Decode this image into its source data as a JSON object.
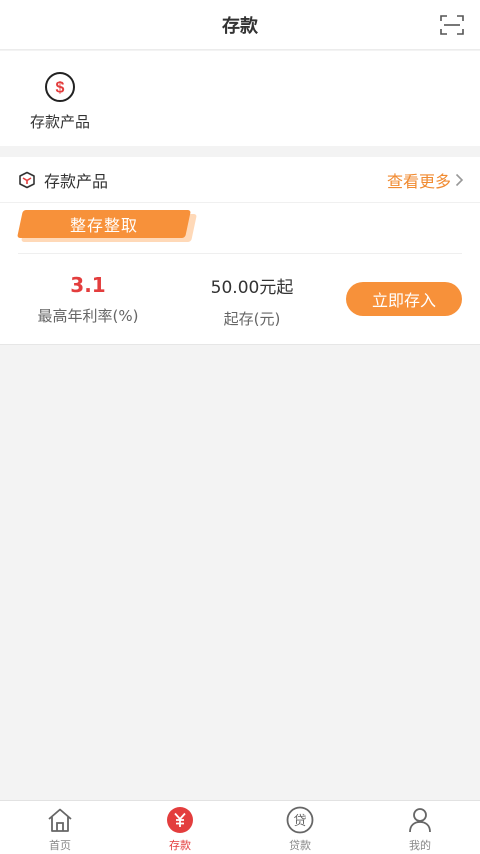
{
  "header": {
    "title": "存款"
  },
  "quick": {
    "items": [
      {
        "label": "存款产品"
      }
    ]
  },
  "section": {
    "title": "存款产品",
    "more_label": "查看更多",
    "tag": "整存整取",
    "product": {
      "rate_value": "3.1",
      "rate_label": "最高年利率(%)",
      "min_value": "50.00元起",
      "min_label": "起存(元)",
      "button_label": "立即存入"
    }
  },
  "tabbar": {
    "items": [
      {
        "label": "首页",
        "icon": "home-icon",
        "active": false
      },
      {
        "label": "存款",
        "icon": "yuan-icon",
        "active": true
      },
      {
        "label": "贷款",
        "icon": "loan-icon",
        "active": false
      },
      {
        "label": "我的",
        "icon": "user-icon",
        "active": false
      }
    ]
  },
  "colors": {
    "accent": "#f7913a",
    "red": "#e33d3d",
    "background": "#f3f3f3"
  }
}
